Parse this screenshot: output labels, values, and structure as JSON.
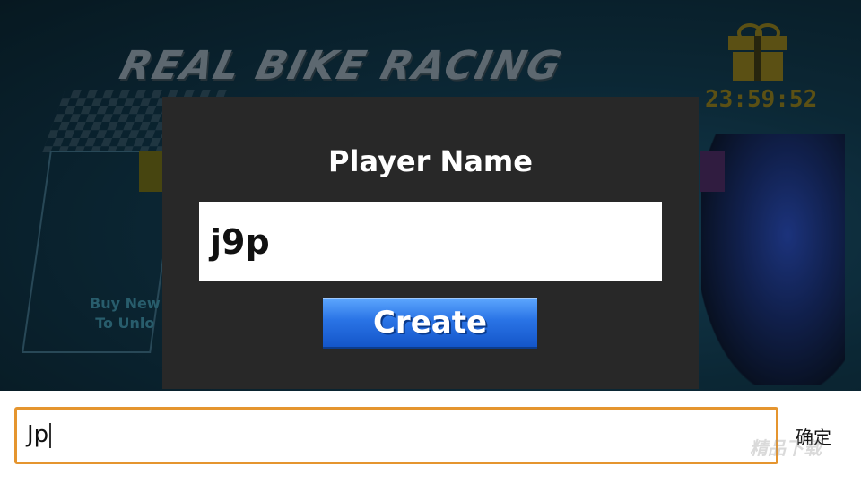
{
  "game": {
    "logo_text": "REAL BIKE RACING",
    "timer": "23:59:52",
    "promo_line1": "Buy New",
    "promo_line2": "To Unlo"
  },
  "dialog": {
    "title": "Player Name",
    "name_value": "j9p",
    "create_label": "Create"
  },
  "ime": {
    "input_value": "Jp",
    "confirm_label": "确定"
  },
  "watermark": {
    "text": "精品下载"
  },
  "colors": {
    "modal_bg": "#282828",
    "create_button": "#2a74e6",
    "ime_border": "#e5952f",
    "gift_gold": "#8c7b1f"
  },
  "icons": [
    "gift-icon"
  ]
}
